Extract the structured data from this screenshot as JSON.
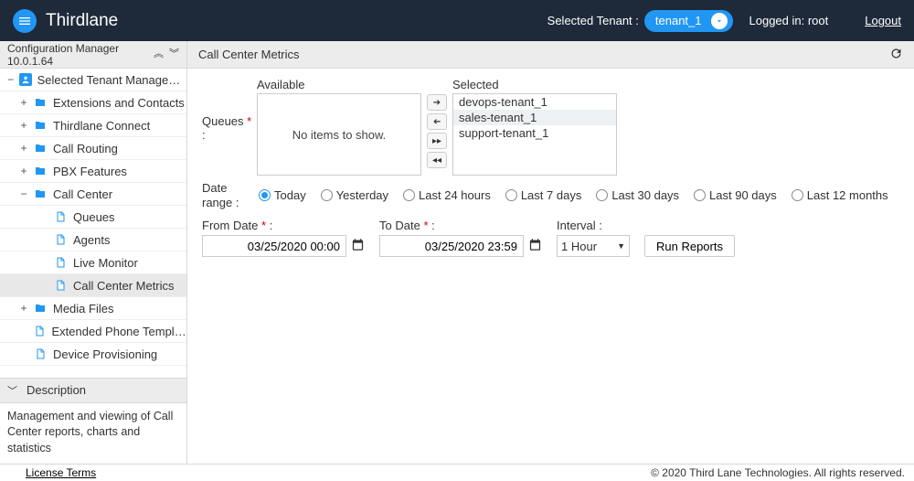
{
  "header": {
    "brand": "Thirdlane",
    "selected_tenant_label": "Selected Tenant :",
    "tenant_name": "tenant_1",
    "logged_in": "Logged in: root",
    "logout": "Logout"
  },
  "sidebar": {
    "title": "Configuration Manager 10.0.1.64",
    "items": [
      {
        "label": "Selected Tenant Management",
        "level": 1,
        "icon": "user",
        "exp": "−"
      },
      {
        "label": "Extensions and Contacts",
        "level": 2,
        "icon": "folder",
        "exp": "+"
      },
      {
        "label": "Thirdlane Connect",
        "level": 2,
        "icon": "folder",
        "exp": "+"
      },
      {
        "label": "Call Routing",
        "level": 2,
        "icon": "folder",
        "exp": "+"
      },
      {
        "label": "PBX Features",
        "level": 2,
        "icon": "folder",
        "exp": "+"
      },
      {
        "label": "Call Center",
        "level": 2,
        "icon": "folder",
        "exp": "−"
      },
      {
        "label": "Queues",
        "level": 3,
        "icon": "doc",
        "exp": ""
      },
      {
        "label": "Agents",
        "level": 3,
        "icon": "doc",
        "exp": ""
      },
      {
        "label": "Live Monitor",
        "level": 3,
        "icon": "doc",
        "exp": ""
      },
      {
        "label": "Call Center Metrics",
        "level": 3,
        "icon": "doc",
        "exp": "",
        "selected": true
      },
      {
        "label": "Media Files",
        "level": 2,
        "icon": "folder",
        "exp": "+"
      },
      {
        "label": "Extended Phone Templat...",
        "level": 2,
        "icon": "doc",
        "exp": ""
      },
      {
        "label": "Device Provisioning",
        "level": 2,
        "icon": "doc",
        "exp": ""
      }
    ],
    "description_title": "Description",
    "description_body": "Management and viewing of Call Center reports, charts and statistics"
  },
  "main": {
    "title": "Call Center Metrics",
    "queues_label": "Queues",
    "available_label": "Available",
    "available_empty": "No items to show.",
    "selected_label": "Selected",
    "selected_items": [
      "devops-tenant_1",
      "sales-tenant_1",
      "support-tenant_1"
    ],
    "date_range_label": "Date range :",
    "range_options": [
      "Today",
      "Yesterday",
      "Last 24 hours",
      "Last 7 days",
      "Last 30 days",
      "Last 90 days",
      "Last 12 months"
    ],
    "range_selected": "Today",
    "from_label": "From Date",
    "from_value": "03/25/2020 00:00",
    "to_label": "To Date",
    "to_value": "03/25/2020 23:59",
    "interval_label": "Interval :",
    "interval_value": "1 Hour",
    "run_button": "Run Reports"
  },
  "footer": {
    "license": "License Terms",
    "copyright": "© 2020 Third Lane Technologies. All rights reserved."
  }
}
